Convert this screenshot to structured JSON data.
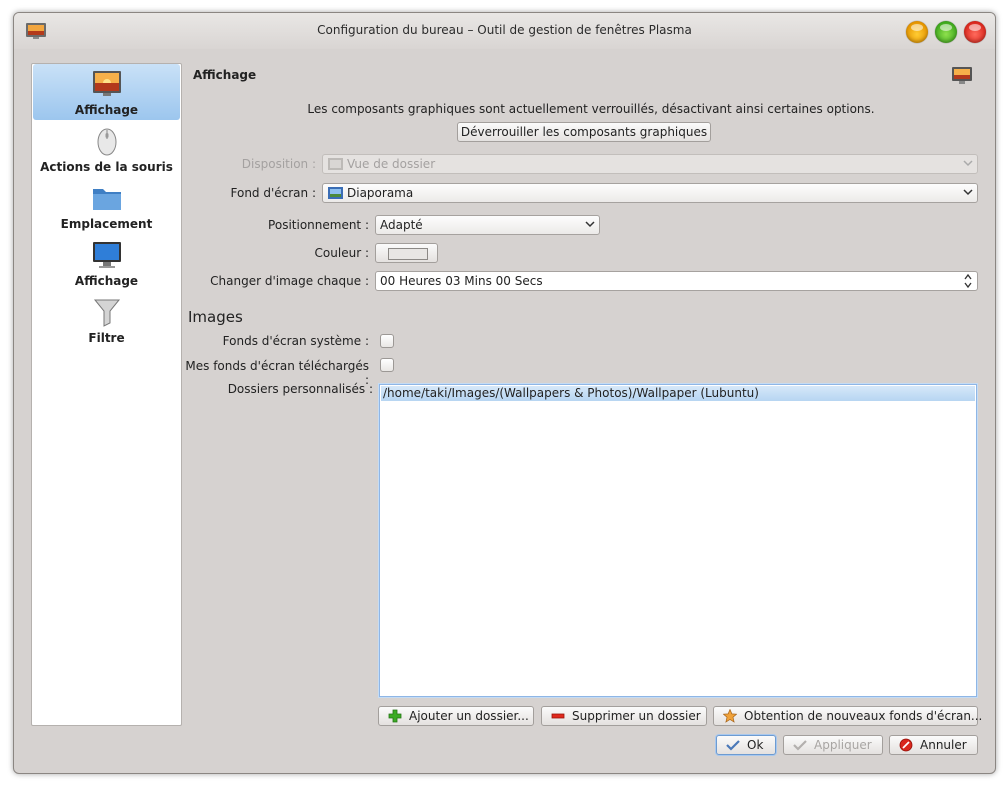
{
  "window": {
    "title": "Configuration du bureau – Outil de gestion de fenêtres Plasma"
  },
  "sidebar": {
    "items": [
      {
        "label": "Affichage",
        "icon": "wallpaper-icon",
        "selected": true
      },
      {
        "label": "Actions de la souris",
        "icon": "mouse-icon",
        "selected": false
      },
      {
        "label": "Emplacement",
        "icon": "folder-icon",
        "selected": false
      },
      {
        "label": "Affichage",
        "icon": "monitor-icon",
        "selected": false
      },
      {
        "label": "Filtre",
        "icon": "funnel-icon",
        "selected": false
      }
    ]
  },
  "main": {
    "title": "Affichage",
    "notice": "Les composants graphiques sont actuellement verrouillés, désactivant ainsi certaines options.",
    "unlock_button": "Déverrouiller les composants graphiques",
    "fields": {
      "disposition_label": "Disposition :",
      "disposition_value": "Vue de dossier",
      "wallpaper_label": "Fond d'écran :",
      "wallpaper_value": "Diaporama",
      "positioning_label": "Positionnement :",
      "positioning_value": "Adapté",
      "color_label": "Couleur :",
      "interval_label": "Changer d'image chaque :",
      "interval_value": "00 Heures 03 Mins 00 Secs"
    },
    "images": {
      "heading": "Images",
      "system_label": "Fonds d'écran système :",
      "downloaded_label": "Mes fonds d'écran téléchargés :",
      "custom_label": "Dossiers personnalisés :",
      "folders": [
        "/home/taki/Images/(Wallpapers & Photos)/Wallpaper (Lubuntu)"
      ]
    },
    "folder_buttons": {
      "add": "Ajouter un dossier...",
      "remove": "Supprimer un dossier",
      "get_new": "Obtention de nouveaux fonds d'écran..."
    }
  },
  "dialog_buttons": {
    "ok": "Ok",
    "apply": "Appliquer",
    "cancel": "Annuler"
  },
  "colors": {
    "window_bg": "#d6d2d0",
    "selection": "#9cc6ee",
    "disabled_text": "#a4a1a0"
  }
}
